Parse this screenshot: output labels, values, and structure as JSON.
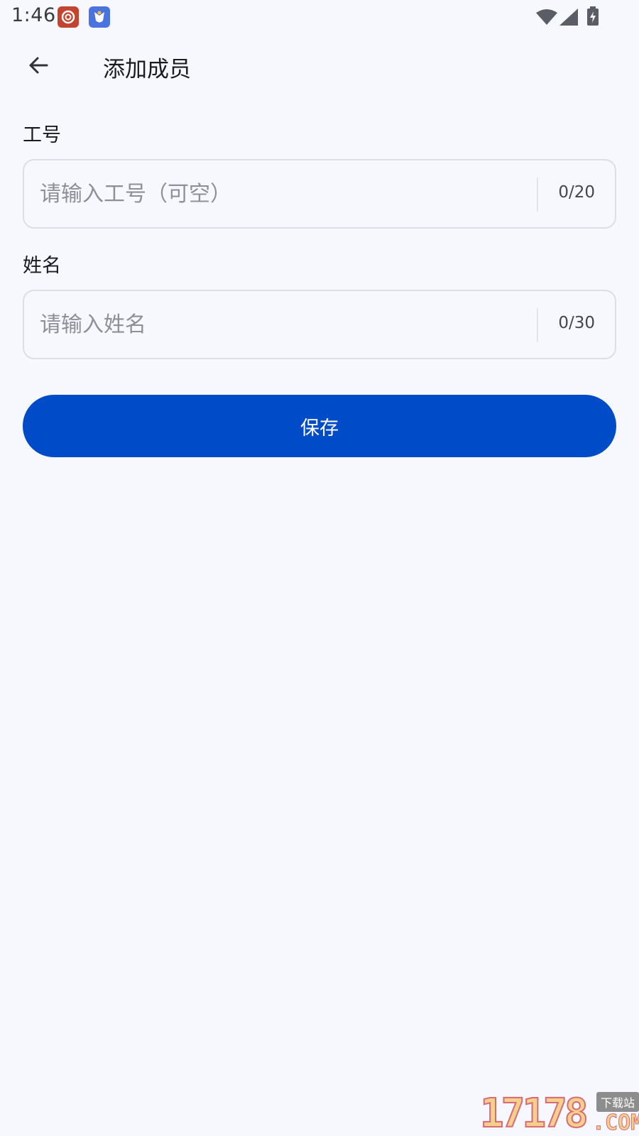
{
  "status_bar": {
    "time": "1:46",
    "icons": [
      "notification-app-icon",
      "notification-app-icon",
      "wifi-icon",
      "signal-icon",
      "battery-charging-icon"
    ]
  },
  "app_bar": {
    "back_icon": "arrow-left-icon",
    "title": "添加成员"
  },
  "form": {
    "employee_id": {
      "label": "工号",
      "value": "",
      "placeholder": "请输入工号（可空）",
      "counter": "0/20"
    },
    "name": {
      "label": "姓名",
      "value": "",
      "placeholder": "请输入姓名",
      "counter": "0/30"
    },
    "save_label": "保存"
  },
  "colors": {
    "background": "#f7f8fe",
    "primary_button": "#004bc7",
    "border": "#dcdde6",
    "placeholder": "#8e9099"
  },
  "watermark": {
    "digits": "17178",
    "badge": "下载站",
    "suffix": ".COM"
  }
}
